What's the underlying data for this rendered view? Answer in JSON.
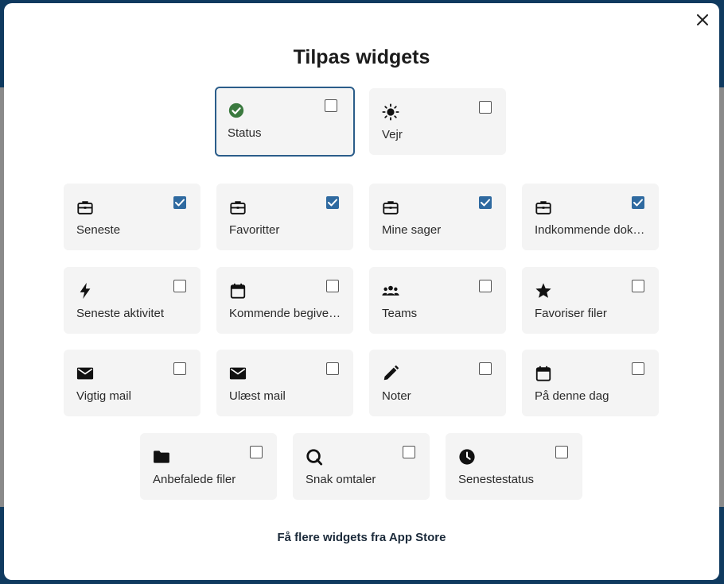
{
  "dialog": {
    "title": "Tilpas widgets",
    "close_icon": "close-icon",
    "app_store_link": "Få flere widgets fra App Store"
  },
  "colors": {
    "accent": "#2f6aa0",
    "selected_border": "#2b5d8a",
    "status_green": "#3b7a3f",
    "tile_bg": "#f4f4f4",
    "backdrop_header": "#0f3a5f"
  },
  "widgets": [
    {
      "label": "Status",
      "icon": "check-circle-icon",
      "checked": false,
      "focused": true
    },
    {
      "label": "Vejr",
      "icon": "sun-icon",
      "checked": false
    },
    {
      "label": "Seneste",
      "icon": "briefcase-icon",
      "checked": true
    },
    {
      "label": "Favoritter",
      "icon": "briefcase-icon",
      "checked": true
    },
    {
      "label": "Mine sager",
      "icon": "briefcase-icon",
      "checked": true
    },
    {
      "label": "Indkommende dok…",
      "icon": "briefcase-icon",
      "checked": true
    },
    {
      "label": "Seneste aktivitet",
      "icon": "lightning-icon",
      "checked": false
    },
    {
      "label": "Kommende begive…",
      "icon": "calendar-icon",
      "checked": false
    },
    {
      "label": "Teams",
      "icon": "people-icon",
      "checked": false
    },
    {
      "label": "Favoriser filer",
      "icon": "star-icon",
      "checked": false
    },
    {
      "label": "Vigtig mail",
      "icon": "mail-icon",
      "checked": false
    },
    {
      "label": "Ulæst mail",
      "icon": "mail-icon",
      "checked": false
    },
    {
      "label": "Noter",
      "icon": "pencil-icon",
      "checked": false
    },
    {
      "label": "På denne dag",
      "icon": "calendar-icon",
      "checked": false
    },
    {
      "label": "Anbefalede filer",
      "icon": "folder-icon",
      "checked": false
    },
    {
      "label": "Snak omtaler",
      "icon": "chat-mention-icon",
      "checked": false
    },
    {
      "label": "Senestestatus",
      "icon": "clock-icon",
      "checked": false
    }
  ]
}
